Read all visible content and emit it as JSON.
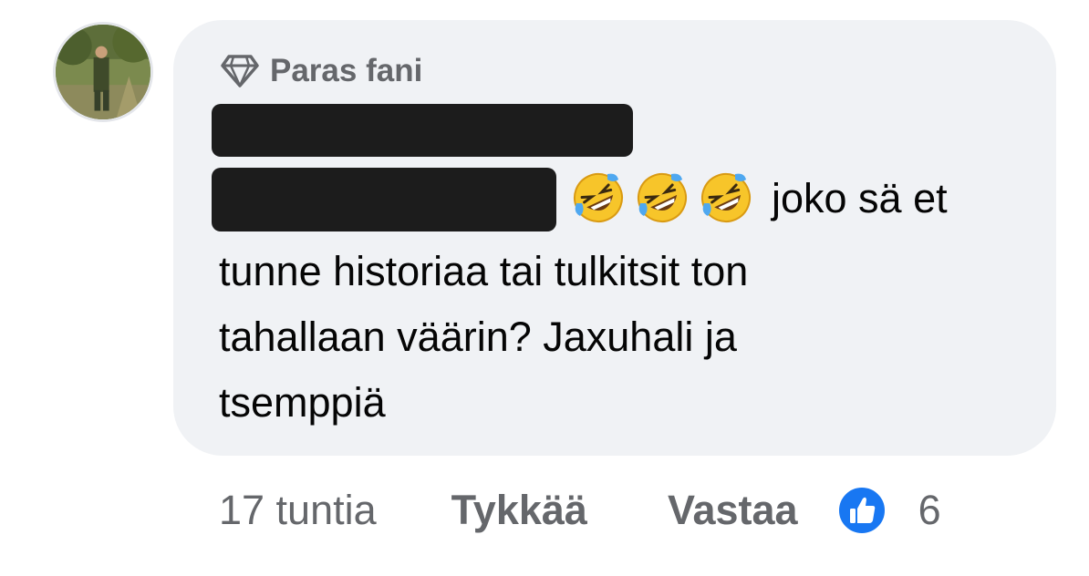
{
  "comment": {
    "badge_label": "Paras fani",
    "first_line_tail": "joko sä et",
    "body_lines": [
      "tunne historiaa tai tulkitsit ton",
      "tahallaan väärin? Jaxuhali ja",
      "tsemppiä"
    ],
    "emojis": [
      "🤣",
      "🤣",
      "🤣"
    ]
  },
  "actions": {
    "time": "17 tuntia",
    "like_label": "Tykkää",
    "reply_label": "Vastaa",
    "like_count": "6"
  },
  "colors": {
    "bubble": "#f0f2f5",
    "secondary_text": "#65676b",
    "primary_text": "#050505",
    "like_blue": "#1877f2",
    "redaction": "#1c1c1c"
  },
  "icons": {
    "badge": "diamond-icon",
    "reaction": "like-thumb-icon",
    "emoji": "rolling-on-floor-laughing-emoji"
  }
}
